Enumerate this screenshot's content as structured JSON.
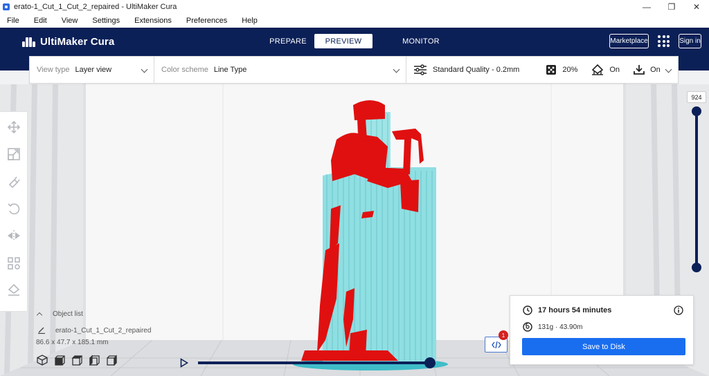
{
  "window": {
    "title": "erato-1_Cut_1_Cut_2_repaired - UltiMaker Cura"
  },
  "menu": [
    "File",
    "Edit",
    "View",
    "Settings",
    "Extensions",
    "Preferences",
    "Help"
  ],
  "header": {
    "logo": "UltiMaker Cura",
    "tabs": [
      "PREPARE",
      "PREVIEW",
      "MONITOR"
    ],
    "active_tab": "PREVIEW",
    "marketplace": "Marketplace",
    "signin": "Sign in"
  },
  "toolbar": {
    "view_type_label": "View type",
    "view_type_value": "Layer view",
    "color_scheme_label": "Color scheme",
    "color_scheme_value": "Line Type",
    "quality": "Standard Quality - 0.2mm",
    "infill": "20%",
    "support": "On",
    "adhesion": "On"
  },
  "left_tools": [
    "move-icon",
    "scale-icon",
    "rotate-icon",
    "undo-rotate-icon",
    "mirror-icon",
    "per-model-settings-icon",
    "support-blocker-icon"
  ],
  "object_list": {
    "label": "Object list",
    "object_name": "erato-1_Cut_1_Cut_2_repaired",
    "dimensions": "86.6 x 47.7 x 185.1 mm"
  },
  "layer_slider": {
    "current_layer": "924"
  },
  "print_info": {
    "time": "17 hours 54 minutes",
    "material": "131g · 43.90m",
    "save_label": "Save to Disk"
  },
  "gcode_badge": "1",
  "colors": {
    "header_bg": "#0b2057",
    "accent_blue": "#196ef0",
    "model_red": "#e01010",
    "support_cyan": "#7fd8dc"
  }
}
